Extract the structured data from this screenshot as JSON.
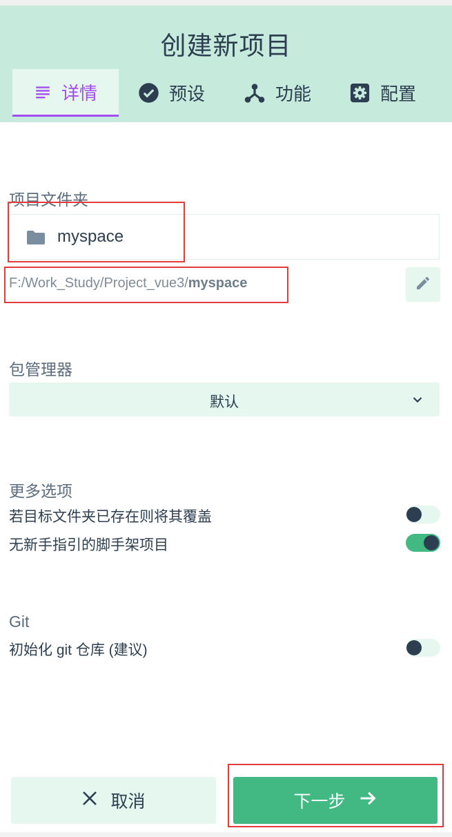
{
  "header": {
    "title": "创建新项目",
    "tabs": [
      {
        "label": "详情",
        "icon": "list-icon",
        "active": true
      },
      {
        "label": "预设",
        "icon": "check-circle-icon",
        "active": false
      },
      {
        "label": "功能",
        "icon": "merge-type-icon",
        "active": false
      },
      {
        "label": "配置",
        "icon": "settings-icon",
        "active": false
      }
    ]
  },
  "folder": {
    "section_label": "项目文件夹",
    "name": "myspace",
    "path_prefix": "F:/Work_Study/Project_vue3/",
    "path_bold": "myspace"
  },
  "package_manager": {
    "section_label": "包管理器",
    "selected": "默认"
  },
  "more_options": {
    "section_label": "更多选项",
    "options": [
      {
        "label": "若目标文件夹已存在则将其覆盖",
        "enabled": false
      },
      {
        "label": "无新手指引的脚手架项目",
        "enabled": true
      }
    ]
  },
  "git": {
    "section_label": "Git",
    "option_label": "初始化 git 仓库 (建议)",
    "enabled": false
  },
  "footer": {
    "cancel_label": "取消",
    "next_label": "下一步"
  },
  "colors": {
    "header_bg": "#c6eadb",
    "accent_green": "#42b983",
    "active_tab": "#a44cf0",
    "text": "#2c3e50",
    "highlight_box": "#e23b3b"
  }
}
